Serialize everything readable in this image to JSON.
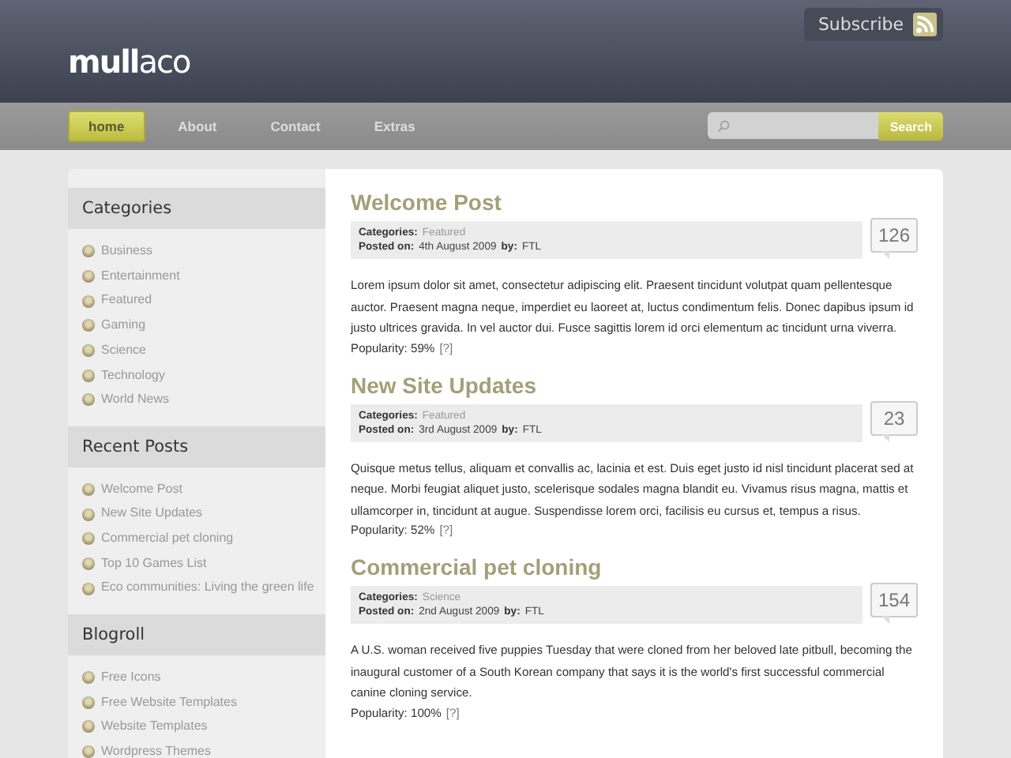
{
  "header": {
    "logo": "**mull**aco",
    "subscribe": "Subscribe"
  },
  "nav": {
    "items": [
      {
        "label": "home",
        "selected": true
      },
      {
        "label": "About",
        "selected": false
      },
      {
        "label": "Contact",
        "selected": false
      },
      {
        "label": "Extras",
        "selected": false
      }
    ],
    "search_button": "Search"
  },
  "sidebar": [
    {
      "title": "Categories",
      "items": [
        "Business",
        "Entertainment",
        "Featured",
        "Gaming",
        "Science",
        "Technology",
        "World News"
      ]
    },
    {
      "title": "Recent Posts",
      "items": [
        "Welcome Post",
        "New Site Updates",
        "Commercial pet cloning",
        "Top 10 Games List",
        "Eco communities: Living the green life"
      ]
    },
    {
      "title": "Blogroll",
      "items": [
        "Free Icons",
        "Free Website Templates",
        "Website Templates",
        "Wordpress Themes"
      ]
    }
  ],
  "posts": [
    {
      "title": "Welcome Post",
      "categories_label": "Categories:",
      "category": "Featured",
      "posted_label": "Posted on:",
      "date": "4th August 2009",
      "by_label": "by:",
      "author": "FTL",
      "comments": "126",
      "body": "Lorem ipsum dolor sit amet, consectetur adipiscing elit. Praesent tincidunt volutpat quam pellentesque auctor. Praesent magna neque, imperdiet eu laoreet at, luctus condimentum felis. Donec dapibus ipsum id justo ultrices gravida. In vel auctor dui. Fusce sagittis lorem id orci elementum ac tincidunt urna viverra.",
      "popularity": "Popularity: 59%",
      "help": "[?]"
    },
    {
      "title": "New Site Updates",
      "categories_label": "Categories:",
      "category": "Featured",
      "posted_label": "Posted on:",
      "date": "3rd August 2009",
      "by_label": "by:",
      "author": "FTL",
      "comments": "23",
      "body": "Quisque metus tellus, aliquam et convallis ac, lacinia et est. Duis eget justo id nisl tincidunt placerat sed at neque. Morbi feugiat aliquet justo, scelerisque sodales magna blandit eu. Vivamus risus magna, mattis et ullamcorper in, tincidunt at augue. Suspendisse lorem orci, facilisis eu cursus et, tempus a risus.",
      "popularity": "Popularity: 52%",
      "help": "[?]"
    },
    {
      "title": "Commercial pet cloning",
      "categories_label": "Categories:",
      "category": "Science",
      "posted_label": "Posted on:",
      "date": "2nd August 2009",
      "by_label": "by:",
      "author": "FTL",
      "comments": "154",
      "body": "A U.S. woman received five puppies Tuesday that were cloned from her beloved late pitbull, becoming the inaugural customer of a South Korean company that says it is the world's first successful commercial canine cloning service.",
      "popularity": "Popularity: 100%",
      "help": "[?]"
    }
  ]
}
